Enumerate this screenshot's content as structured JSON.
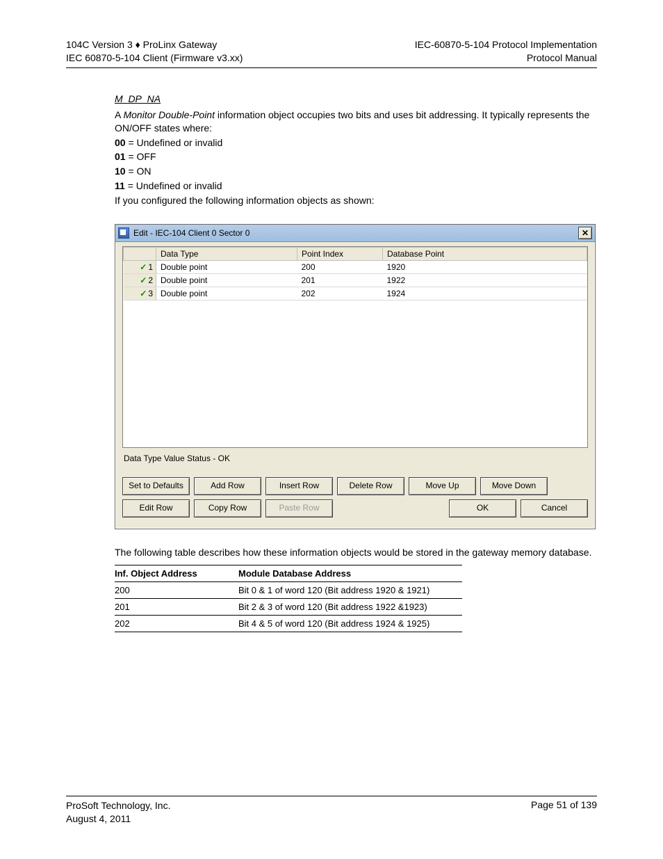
{
  "header": {
    "left1": "104C Version 3 ♦ ProLinx Gateway",
    "left2": "IEC 60870-5-104 Client (Firmware v3.xx)",
    "right1": "IEC-60870-5-104 Protocol Implementation",
    "right2": "Protocol Manual"
  },
  "section": {
    "title": "M_DP_NA",
    "intro_a": "A ",
    "intro_b": "Monitor Double-Point",
    "intro_c": " information object occupies two bits and uses bit addressing. It typically represents the ON/OFF states where:",
    "states": [
      {
        "code": "00",
        "desc": " = Undefined or invalid"
      },
      {
        "code": "01",
        "desc": " = OFF"
      },
      {
        "code": "10",
        "desc": " = ON"
      },
      {
        "code": "11",
        "desc": " = Undefined or invalid"
      }
    ],
    "config_line": "If you configured the following information objects as shown:"
  },
  "dialog": {
    "title": "Edit - IEC-104 Client 0 Sector 0",
    "columns": [
      "",
      "Data Type",
      "Point Index",
      "Database Point"
    ],
    "rows": [
      {
        "num": "1",
        "type": "Double point",
        "pidx": "200",
        "dbp": "1920"
      },
      {
        "num": "2",
        "type": "Double point",
        "pidx": "201",
        "dbp": "1922"
      },
      {
        "num": "3",
        "type": "Double point",
        "pidx": "202",
        "dbp": "1924"
      }
    ],
    "status": "Data Type Value Status - OK",
    "buttons": {
      "set_defaults": "Set to Defaults",
      "add_row": "Add Row",
      "insert_row": "Insert Row",
      "delete_row": "Delete Row",
      "move_up": "Move Up",
      "move_down": "Move Down",
      "edit_row": "Edit Row",
      "copy_row": "Copy Row",
      "paste_row": "Paste Row",
      "ok": "OK",
      "cancel": "Cancel"
    }
  },
  "post": {
    "para": "The following table describes how these information objects would be stored in the gateway memory database.",
    "headers": [
      "Inf. Object Address",
      "Module Database Address"
    ],
    "rows": [
      {
        "addr": "200",
        "desc": "Bit 0 & 1 of word 120 (Bit address 1920 & 1921)"
      },
      {
        "addr": "201",
        "desc": "Bit 2 & 3 of word 120 (Bit address 1922 &1923)"
      },
      {
        "addr": "202",
        "desc": "Bit 4 & 5 of word 120 (Bit address 1924 & 1925)"
      }
    ]
  },
  "footer": {
    "company": "ProSoft Technology, Inc.",
    "date": "August 4, 2011",
    "page": "Page 51 of 139"
  }
}
